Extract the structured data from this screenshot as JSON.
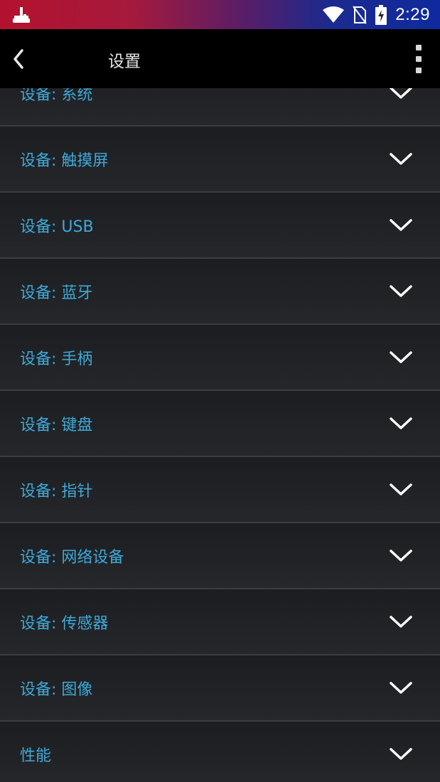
{
  "status_bar": {
    "time": "2:29",
    "icons": [
      "joystick-icon",
      "wifi-icon",
      "no-sim-icon",
      "battery-charging-icon"
    ]
  },
  "app_bar": {
    "title": "设置",
    "back_icon": "chevron-left-icon",
    "menu_icon": "overflow-menu-icon"
  },
  "list": {
    "items": [
      {
        "label": "设备: 系统"
      },
      {
        "label": "设备: 触摸屏"
      },
      {
        "label": "设备: USB"
      },
      {
        "label": "设备: 蓝牙"
      },
      {
        "label": "设备: 手柄"
      },
      {
        "label": "设备: 键盘"
      },
      {
        "label": "设备: 指针"
      },
      {
        "label": "设备: 网络设备"
      },
      {
        "label": "设备: 传感器"
      },
      {
        "label": "设备: 图像"
      },
      {
        "label": "性能"
      }
    ],
    "expand_icon": "chevron-down-icon"
  },
  "colors": {
    "accent_label": "#3fa9d8",
    "background": "#1f2024",
    "app_bar": "#000000",
    "divider": "#3b3d42"
  }
}
